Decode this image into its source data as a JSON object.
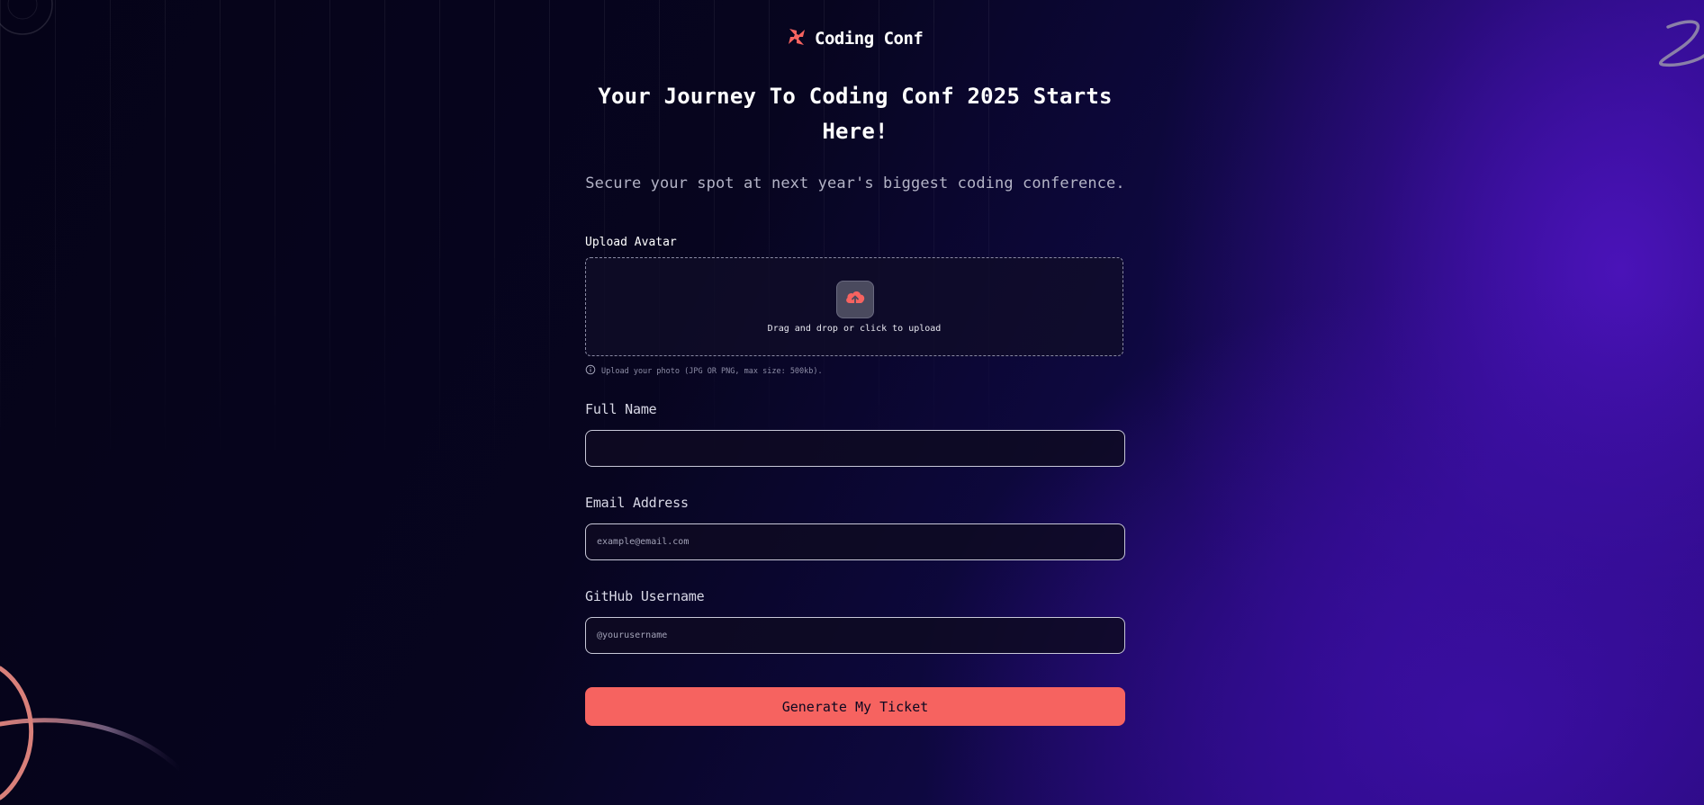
{
  "brand": {
    "name": "Coding Conf",
    "accent_color": "#f66360",
    "logo_icon": "coding-conf-logo-icon"
  },
  "hero": {
    "headline": "Your Journey To Coding Conf 2025 Starts Here!",
    "subtitle": "Secure your spot at next year's biggest coding conference."
  },
  "form": {
    "avatar": {
      "label": "Upload Avatar",
      "dropzone_text": "Drag and drop or click to upload",
      "hint": "Upload your photo (JPG OR PNG, max size: 500kb).",
      "icon": "cloud-upload-icon"
    },
    "full_name": {
      "label": "Full Name",
      "value": "",
      "placeholder": ""
    },
    "email": {
      "label": "Email Address",
      "value": "",
      "placeholder": "example@email.com"
    },
    "github": {
      "label": "GitHub Username",
      "value": "",
      "placeholder": "@yourusername"
    },
    "submit_label": "Generate My Ticket"
  }
}
